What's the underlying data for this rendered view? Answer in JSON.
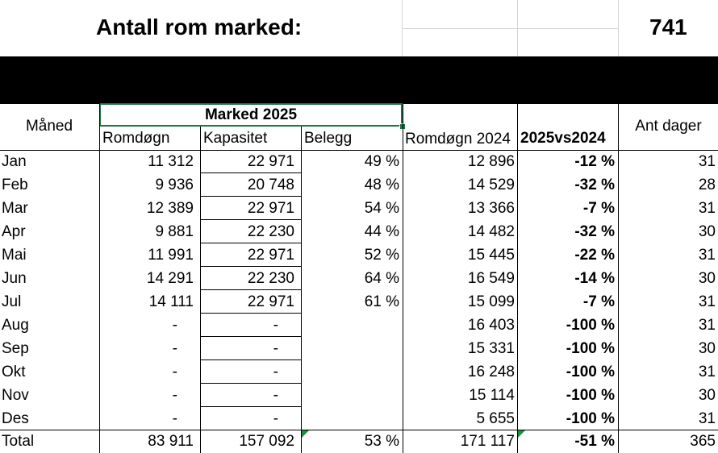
{
  "header": {
    "title": "Antall rom marked:",
    "value": "741"
  },
  "table": {
    "group_header": "Marked 2025",
    "col_month": "Måned",
    "col_romdogn": "Romdøgn",
    "col_kapasitet": "Kapasitet",
    "col_belegg": "Belegg",
    "col_romdogn2024": "Romdøgn 2024",
    "col_diff": "2025vs2024",
    "col_days": "Ant dager",
    "rows": [
      {
        "month": "Jan",
        "romdogn": "11 312",
        "kapasitet": "22 971",
        "belegg": "49 %",
        "r2024": "12 896",
        "diff": "-12 %",
        "days": "31"
      },
      {
        "month": "Feb",
        "romdogn": "9 936",
        "kapasitet": "20 748",
        "belegg": "48 %",
        "r2024": "14 529",
        "diff": "-32 %",
        "days": "28"
      },
      {
        "month": "Mar",
        "romdogn": "12 389",
        "kapasitet": "22 971",
        "belegg": "54 %",
        "r2024": "13 366",
        "diff": "-7 %",
        "days": "31"
      },
      {
        "month": "Apr",
        "romdogn": "9 881",
        "kapasitet": "22 230",
        "belegg": "44 %",
        "r2024": "14 482",
        "diff": "-32 %",
        "days": "30"
      },
      {
        "month": "Mai",
        "romdogn": "11 991",
        "kapasitet": "22 971",
        "belegg": "52 %",
        "r2024": "15 445",
        "diff": "-22 %",
        "days": "31"
      },
      {
        "month": "Jun",
        "romdogn": "14 291",
        "kapasitet": "22 230",
        "belegg": "64 %",
        "r2024": "16 549",
        "diff": "-14 %",
        "days": "30"
      },
      {
        "month": "Jul",
        "romdogn": "14 111",
        "kapasitet": "22 971",
        "belegg": "61 %",
        "r2024": "15 099",
        "diff": "-7 %",
        "days": "31"
      },
      {
        "month": "Aug",
        "romdogn": "-",
        "kapasitet": "-",
        "belegg": "",
        "r2024": "16 403",
        "diff": "-100 %",
        "days": "31"
      },
      {
        "month": "Sep",
        "romdogn": "-",
        "kapasitet": "-",
        "belegg": "",
        "r2024": "15 331",
        "diff": "-100 %",
        "days": "30"
      },
      {
        "month": "Okt",
        "romdogn": "-",
        "kapasitet": "-",
        "belegg": "",
        "r2024": "16 248",
        "diff": "-100 %",
        "days": "31"
      },
      {
        "month": "Nov",
        "romdogn": "-",
        "kapasitet": "-",
        "belegg": "",
        "r2024": "15 114",
        "diff": "-100 %",
        "days": "30"
      },
      {
        "month": "Des",
        "romdogn": "-",
        "kapasitet": "-",
        "belegg": "",
        "r2024": "5 655",
        "diff": "-100 %",
        "days": "31"
      }
    ],
    "total": {
      "month": "Total",
      "romdogn": "83 911",
      "kapasitet": "157 092",
      "belegg": "53 %",
      "r2024": "171 117",
      "diff": "-51 %",
      "days": "365"
    }
  },
  "colors": {
    "selection": "#217346",
    "gridline": "#d4d4d4",
    "comment_marker": "#1e8e3e"
  }
}
